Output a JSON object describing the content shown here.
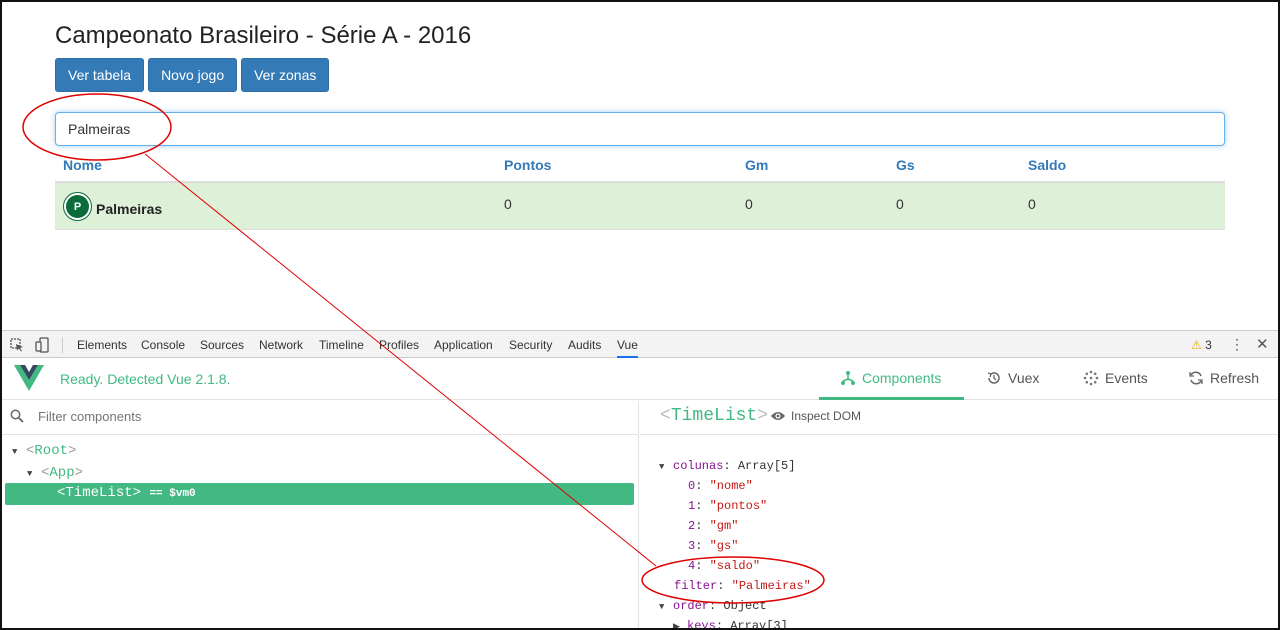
{
  "page": {
    "title": "Campeonato Brasileiro - Série A - 2016",
    "buttons": [
      "Ver tabela",
      "Novo jogo",
      "Ver zonas"
    ],
    "search_value": "Palmeiras"
  },
  "table": {
    "headers": [
      "Nome",
      "Pontos",
      "Gm",
      "Gs",
      "Saldo"
    ],
    "rows": [
      {
        "nome": "Palmeiras",
        "pontos": "0",
        "gm": "0",
        "gs": "0",
        "saldo": "0"
      }
    ]
  },
  "devtools": {
    "tabs": [
      "Elements",
      "Console",
      "Sources",
      "Network",
      "Timeline",
      "Profiles",
      "Application",
      "Security",
      "Audits",
      "Vue"
    ],
    "active_tab": "Vue",
    "warnings": "3",
    "vue": {
      "status": "Ready. Detected Vue 2.1.8.",
      "tabs": [
        "Components",
        "Vuex",
        "Events",
        "Refresh"
      ],
      "filter_placeholder": "Filter components",
      "tree": {
        "root": "Root",
        "app": "App",
        "selected": "TimeList",
        "selected_suffix": "== $vm0"
      },
      "component_name": "TimeList",
      "inspect_dom": "Inspect DOM",
      "props": {
        "colunas_key": "colunas",
        "colunas_type": "Array[5]",
        "colunas": [
          "\"nome\"",
          "\"pontos\"",
          "\"gm\"",
          "\"gs\"",
          "\"saldo\""
        ],
        "filter_key": "filter",
        "filter_value": "\"Palmeiras\"",
        "order_key": "order",
        "order_type": "Object",
        "keys_key": "keys",
        "keys_type": "Array[3]"
      }
    }
  },
  "colors": {
    "primary": "#337ab7",
    "vue_green": "#42b983",
    "row_success": "#dff0d8",
    "annotation": "#e00000"
  }
}
